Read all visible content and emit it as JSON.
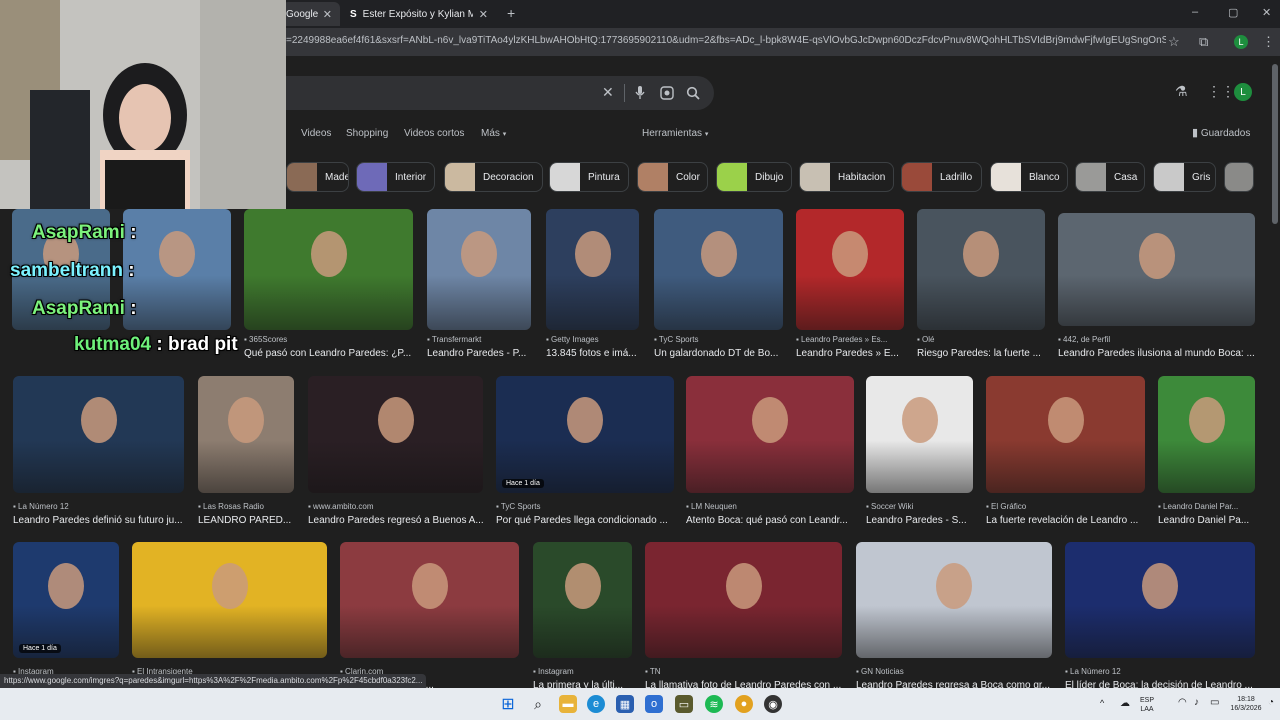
{
  "tabs": [
    {
      "title": "Google",
      "close": "✕"
    },
    {
      "title": "Ester Expósito y Kylian Mbappé",
      "close": "✕"
    }
  ],
  "new_tab": "+",
  "window_controls": [
    "–",
    "▢",
    "✕"
  ],
  "url": "=2249988ea6ef4f61&sxsrf=ANbL-n6v_lva9TiTAo4ylzKHLbwAHObHtQ:1773695902110&udm=2&fbs=ADc_l-bpk8W4E-qsVlOvbGJcDwpn60DczFdcvPnuv8WQohHLTbSVIdBrj9mdwFjfwIgEUgSngOnSDVho99FxfCh...",
  "profile_letter": "L",
  "nav_tabs": [
    "Videos",
    "Shopping",
    "Videos cortos",
    "Más"
  ],
  "tools": "Herramientas",
  "saved": "Guardados",
  "chips": [
    "Madera",
    "Interior",
    "Decoracion",
    "Pintura",
    "Color",
    "Dibujo",
    "Habitacion",
    "Ladrillo",
    "Blanco",
    "Casa",
    "Gris"
  ],
  "chip_colors": [
    "#8a6a55",
    "#6e6ab8",
    "#cbb9a0",
    "#d7d7d7",
    "#b08065",
    "#9bd14a",
    "#c8c0b3",
    "#9a4a3a",
    "#e7e1da",
    "#9a9a98",
    "#c9c9c9"
  ],
  "results": [
    {
      "source": "",
      "title": "",
      "color": "#4a6b8a"
    },
    {
      "source": "",
      "title": "",
      "color": "#5a7fa8"
    },
    {
      "source": "365Scores",
      "title": "Qué pasó con Leandro Paredes: ¿P...",
      "color": "#3f7a2e"
    },
    {
      "source": "Transfermarkt",
      "title": "Leandro Paredes - P...",
      "color": "#6e86a6"
    },
    {
      "source": "Getty Images",
      "title": "13.845 fotos e imá...",
      "color": "#2d3f5e"
    },
    {
      "source": "TyC Sports",
      "title": "Un galardonado DT de Bo...",
      "color": "#3f5b7e"
    },
    {
      "source": "Leandro Paredes » Es...",
      "title": "Leandro Paredes » E...",
      "color": "#b3282a"
    },
    {
      "source": "Olé",
      "title": "Riesgo Paredes: la fuerte ...",
      "color": "#49545e"
    },
    {
      "source": "442, de Perfil",
      "title": "Leandro Paredes ilusiona al mundo Boca: ...",
      "color": "#5c6670"
    },
    {
      "source": "La Número 12",
      "title": "Leandro Paredes definió su futuro ju...",
      "color": "#223855"
    },
    {
      "source": "Las Rosas Radio",
      "title": "LEANDRO PARED...",
      "color": "#8d7d70"
    },
    {
      "source": "www.ambito.com",
      "title": "Leandro Paredes regresó a Buenos A...",
      "color": "#2a1f24"
    },
    {
      "source": "TyC Sports",
      "title": "Por qué Paredes llega condicionado ...",
      "color": "#1b2d52"
    },
    {
      "source": "LM Neuquen",
      "title": "Atento Boca: qué pasó con Leandr...",
      "color": "#8a2f3b"
    },
    {
      "source": "Soccer Wiki",
      "title": "Leandro Paredes - S...",
      "color": "#e8e8e8"
    },
    {
      "source": "El Gráfico",
      "title": "La fuerte revelación de Leandro ...",
      "color": "#8a3a30"
    },
    {
      "source": "Leandro Daniel Par...",
      "title": "Leandro Daniel Pa...",
      "color": "#3d8a3a"
    },
    {
      "source": "Instagram",
      "title": "",
      "color": "#1e3a6e"
    },
    {
      "source": "El Intransigente",
      "title": "",
      "color": "#e2b324"
    },
    {
      "source": "Clarin.com",
      "title": "el sueño de Boca p...",
      "color": "#8c3b40"
    },
    {
      "source": "Instagram",
      "title": "La primera y la últi...",
      "color": "#2a4a2a"
    },
    {
      "source": "TN",
      "title": "La llamativa foto de Leandro Paredes con ...",
      "color": "#7a2530"
    },
    {
      "source": "GN Noticias",
      "title": "Leandro Paredes regresa a Boca como gr...",
      "color": "#c0c6d0"
    },
    {
      "source": "La Número 12",
      "title": "El líder de Boca: la decisión de Leandro ...",
      "color": "#1c2d6e"
    }
  ],
  "badge_text": "Hace 1 día",
  "status_url": "https://www.google.com/imgres?q=paredes&imgurl=https%3A%2F%2Fmedia.ambito.com%2Fp%2F45cbdf0a323fc2...",
  "chat": [
    {
      "user": "AsapRami",
      "text": ":",
      "color": "#7cf27c"
    },
    {
      "user": "sambeltrann",
      "text": ":",
      "color": "#7cf2ff"
    },
    {
      "user": "AsapRami",
      "text": ":",
      "color": "#7cf27c"
    },
    {
      "user": "kutma04",
      "text": ": brad pit",
      "color": "#6ef07a"
    }
  ],
  "tray": {
    "lang1": "ESP",
    "lang2": "LAA",
    "time": "18:18",
    "date": "16/3/2026",
    "caret": "^"
  }
}
